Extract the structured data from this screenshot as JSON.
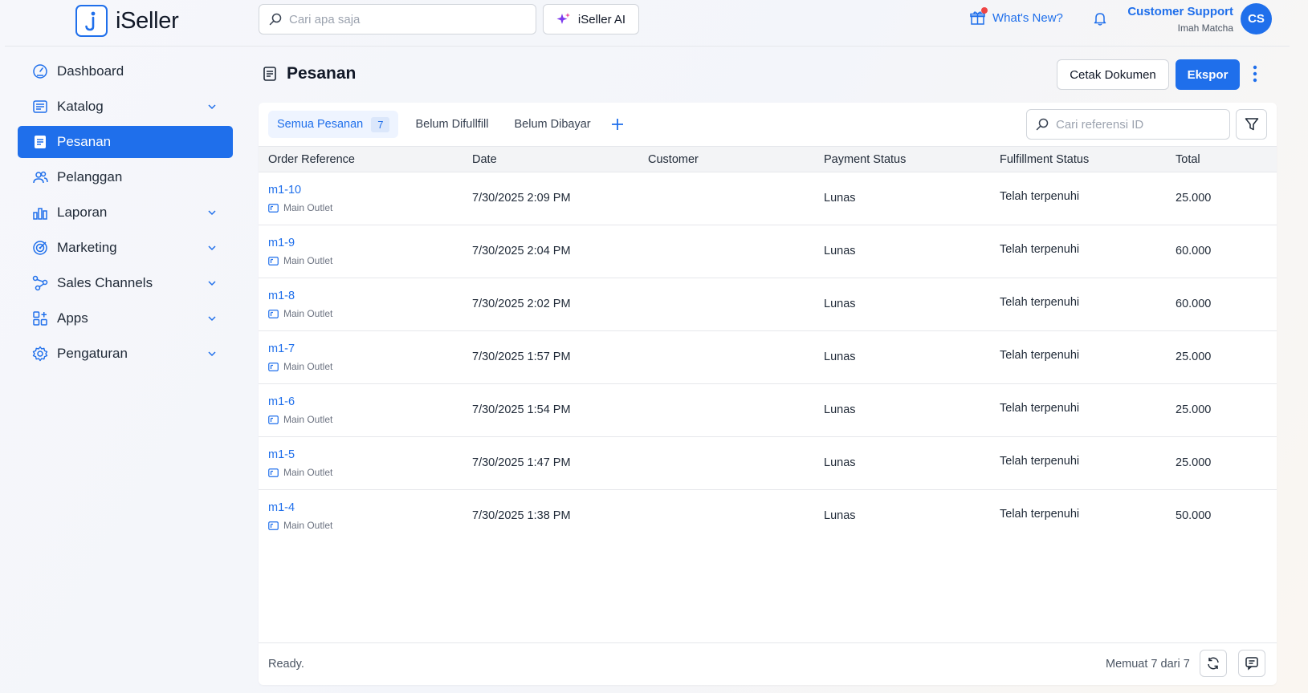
{
  "header": {
    "brand": "iSeller",
    "search_placeholder": "Cari apa saja",
    "ai_label": "iSeller AI",
    "whats_new": "What's New?",
    "user_name": "Customer Support",
    "user_org": "Imah Matcha",
    "avatar_initials": "CS"
  },
  "sidebar": {
    "items": [
      {
        "label": "Dashboard",
        "icon": "dashboard-icon",
        "expandable": false,
        "active": false
      },
      {
        "label": "Katalog",
        "icon": "catalog-icon",
        "expandable": true,
        "active": false
      },
      {
        "label": "Pesanan",
        "icon": "orders-icon",
        "expandable": false,
        "active": true
      },
      {
        "label": "Pelanggan",
        "icon": "customers-icon",
        "expandable": false,
        "active": false
      },
      {
        "label": "Laporan",
        "icon": "reports-icon",
        "expandable": true,
        "active": false
      },
      {
        "label": "Marketing",
        "icon": "marketing-icon",
        "expandable": true,
        "active": false
      },
      {
        "label": "Sales Channels",
        "icon": "sales-channels-icon",
        "expandable": true,
        "active": false
      },
      {
        "label": "Apps",
        "icon": "apps-icon",
        "expandable": true,
        "active": false
      },
      {
        "label": "Pengaturan",
        "icon": "settings-icon",
        "expandable": true,
        "active": false
      }
    ]
  },
  "page": {
    "title": "Pesanan",
    "print_label": "Cetak Dokumen",
    "export_label": "Ekspor"
  },
  "tabs": [
    {
      "label": "Semua Pesanan",
      "count": "7",
      "active": true
    },
    {
      "label": "Belum Difullfill",
      "active": false
    },
    {
      "label": "Belum Dibayar",
      "active": false
    }
  ],
  "ref_search_placeholder": "Cari referensi ID",
  "table": {
    "columns": [
      "Order Reference",
      "Date",
      "Customer",
      "Payment Status",
      "Fulfillment Status",
      "Total"
    ],
    "rows": [
      {
        "ref": "m1-10",
        "outlet": "Main Outlet",
        "date": "7/30/2025 2:09 PM",
        "customer": "",
        "payment": "Lunas",
        "fulfillment": "Telah terpenuhi",
        "total": "25.000"
      },
      {
        "ref": "m1-9",
        "outlet": "Main Outlet",
        "date": "7/30/2025 2:04 PM",
        "customer": "",
        "payment": "Lunas",
        "fulfillment": "Telah terpenuhi",
        "total": "60.000"
      },
      {
        "ref": "m1-8",
        "outlet": "Main Outlet",
        "date": "7/30/2025 2:02 PM",
        "customer": "",
        "payment": "Lunas",
        "fulfillment": "Telah terpenuhi",
        "total": "60.000"
      },
      {
        "ref": "m1-7",
        "outlet": "Main Outlet",
        "date": "7/30/2025 1:57 PM",
        "customer": "",
        "payment": "Lunas",
        "fulfillment": "Telah terpenuhi",
        "total": "25.000"
      },
      {
        "ref": "m1-6",
        "outlet": "Main Outlet",
        "date": "7/30/2025 1:54 PM",
        "customer": "",
        "payment": "Lunas",
        "fulfillment": "Telah terpenuhi",
        "total": "25.000"
      },
      {
        "ref": "m1-5",
        "outlet": "Main Outlet",
        "date": "7/30/2025 1:47 PM",
        "customer": "",
        "payment": "Lunas",
        "fulfillment": "Telah terpenuhi",
        "total": "25.000"
      },
      {
        "ref": "m1-4",
        "outlet": "Main Outlet",
        "date": "7/30/2025 1:38 PM",
        "customer": "",
        "payment": "Lunas",
        "fulfillment": "Telah terpenuhi",
        "total": "50.000"
      }
    ]
  },
  "footer": {
    "status": "Ready.",
    "loaded": "Memuat 7 dari 7"
  },
  "colors": {
    "accent": "#1f6feb",
    "notification_dot": "#ef4444"
  }
}
